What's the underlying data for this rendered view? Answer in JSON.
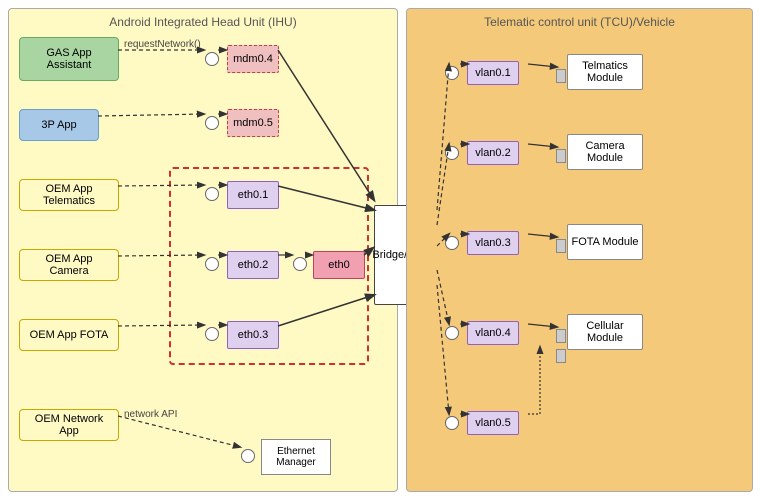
{
  "ihu": {
    "title": "Android Integrated Head Unit (IHU)",
    "apps": [
      {
        "id": "gas",
        "label": "GAS App Assistant",
        "style": "gas-app"
      },
      {
        "id": "3p",
        "label": "3P App",
        "style": "app-3p"
      },
      {
        "id": "oem-telematics",
        "label": "OEM App Telematics",
        "style": "app-oem-telematics"
      },
      {
        "id": "oem-camera",
        "label": "OEM App Camera",
        "style": "app-oem-camera"
      },
      {
        "id": "oem-fota",
        "label": "OEM App FOTA",
        "style": "app-oem-fota"
      },
      {
        "id": "oem-network",
        "label": "OEM Network App",
        "style": "app-oem-network"
      }
    ],
    "mdm": [
      {
        "id": "mdm04",
        "label": "mdm0.4"
      },
      {
        "id": "mdm05",
        "label": "mdm0.5"
      }
    ],
    "eth": [
      {
        "id": "eth01",
        "label": "eth0.1"
      },
      {
        "id": "eth02",
        "label": "eth0.2"
      },
      {
        "id": "eth03",
        "label": "eth0.3"
      }
    ],
    "eth0": {
      "label": "eth0"
    },
    "bridge": {
      "label": "Bridge/Switch"
    },
    "eth_manager": {
      "label": "Ethernet Manager"
    },
    "labels": {
      "request_network": "requestNetwork()",
      "network_api": "network API"
    }
  },
  "tcu": {
    "title": "Telematic control unit (TCU)/Vehicle",
    "vlans": [
      {
        "id": "vlan01",
        "label": "vlan0.1"
      },
      {
        "id": "vlan02",
        "label": "vlan0.2"
      },
      {
        "id": "vlan03",
        "label": "vlan0.3"
      },
      {
        "id": "vlan04",
        "label": "vlan0.4"
      },
      {
        "id": "vlan05",
        "label": "vlan0.5"
      }
    ],
    "modules": [
      {
        "id": "telmatics",
        "label": "Telmatics Module"
      },
      {
        "id": "camera",
        "label": "Camera Module"
      },
      {
        "id": "fota",
        "label": "FOTA Module"
      },
      {
        "id": "cellular",
        "label": "Cellular Module"
      }
    ]
  }
}
